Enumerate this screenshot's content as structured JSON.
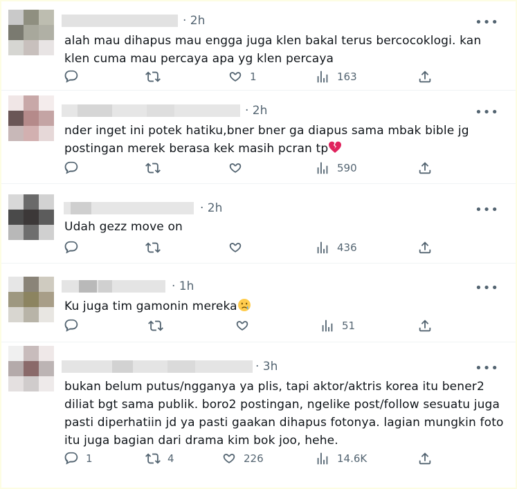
{
  "tweets": [
    {
      "time": "· 2h",
      "text": "alah mau dihapus mau engga juga klen bakal terus bercocoklogi. kan klen cuma mau percaya apa yg klen percaya",
      "replies": "",
      "retweets": "",
      "likes": "1",
      "views": "163"
    },
    {
      "time": "· 2h",
      "text": "nder inget ini potek hatiku,bner bner ga diapus sama mbak bible jg postingan merek berasa kek masih pcran tp",
      "emoji": "broken-heart",
      "replies": "",
      "retweets": "",
      "likes": "",
      "views": "590"
    },
    {
      "time": "· 2h",
      "text": "Udah gezz move on",
      "replies": "",
      "retweets": "",
      "likes": "",
      "views": "436"
    },
    {
      "time": "· 1h",
      "text": "Ku juga tim gamonin mereka",
      "emoji": "crying-face",
      "replies": "",
      "retweets": "",
      "likes": "",
      "views": "51"
    },
    {
      "time": "· 3h",
      "text": "bukan belum putus/ngganya ya plis, tapi aktor/aktris korea itu bener2 diliat bgt sama publik. boro2 postingan, ngelike post/follow sesuatu juga pasti diperhatiin jd ya pasti gaakan dihapus fotonya. lagian mungkin foto itu juga bagian dari drama kim bok joo, hehe.",
      "replies": "1",
      "retweets": "4",
      "likes": "226",
      "views": "14.6K"
    }
  ],
  "icons": {
    "reply": "reply-icon",
    "retweet": "retweet-icon",
    "like": "heart-icon",
    "views": "views-icon",
    "share": "share-icon",
    "more": "more-icon"
  },
  "colors": {
    "text": "#0f1419",
    "muted": "#536471",
    "broken_heart": "#e0245e",
    "emoji_face": "#ffcc4d"
  },
  "more_label": "•••"
}
